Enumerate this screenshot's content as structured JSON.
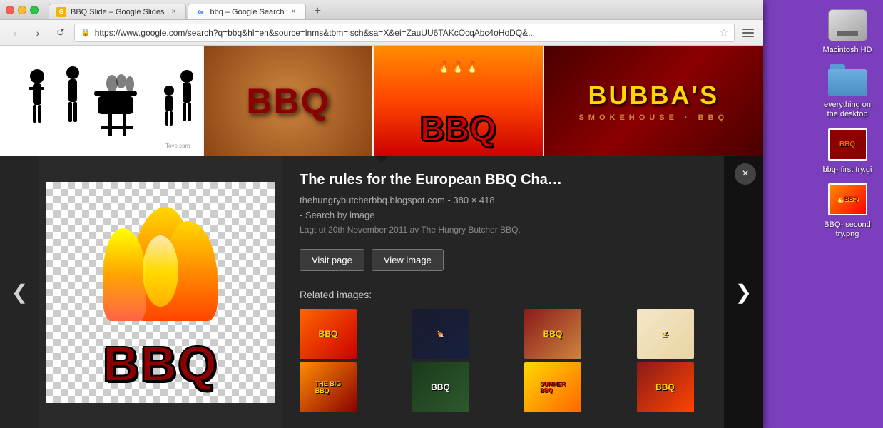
{
  "desktop": {
    "background_color": "#7B3FBE"
  },
  "desktop_icons": [
    {
      "id": "macintosh-hd",
      "label": "Macintosh HD",
      "type": "hard-drive"
    },
    {
      "id": "everything-on-the-desktop",
      "label": "everything on the desktop",
      "type": "folder"
    },
    {
      "id": "bbq-first-try",
      "label": "bbq- first try.gi",
      "type": "bbq-gif"
    },
    {
      "id": "bbq-second-try",
      "label": "BBQ- second try.png",
      "type": "bbq-png"
    }
  ],
  "browser": {
    "tabs": [
      {
        "id": "tab-slides",
        "label": "BBQ Slide – Google Slides",
        "active": false,
        "favicon_type": "slides"
      },
      {
        "id": "tab-search",
        "label": "bbq – Google Search",
        "active": true,
        "favicon_type": "google"
      }
    ],
    "new_tab_label": "+",
    "nav": {
      "back_label": "‹",
      "forward_label": "›",
      "reload_label": "↺",
      "url": "https://www.google.com/search?q=bbq&hl=en&source=lnms&tbm=isch&sa=X&ei=ZauUU6TAKcOcqAbc4oHoDQ&...",
      "url_display": "https://www.google.com/search?q=bbq&hl=en&source=lnms&tbm=isch&sa=X&ei=ZauUU6TAKcOcqAbc4oHoDQ&..."
    }
  },
  "image_overlay": {
    "title": "The rules for the European BBQ Cha…",
    "source": "thehungrybutcherbbq.blogspot.com",
    "dimensions": "380 × 418",
    "search_by_image_label": "- Search by image",
    "date_text": "Lagt ut 20th November 2011 av The Hungry Butcher BBQ.",
    "visit_page_btn": "Visit page",
    "view_image_btn": "View image",
    "related_images_title": "Related images:",
    "related_images": [
      {
        "id": "ri-1",
        "label": "BBQ"
      },
      {
        "id": "ri-2",
        "label": ""
      },
      {
        "id": "ri-3",
        "label": "BBQ"
      },
      {
        "id": "ri-4",
        "label": ""
      },
      {
        "id": "ri-5",
        "label": "BBQ"
      },
      {
        "id": "ri-6",
        "label": ""
      },
      {
        "id": "ri-7",
        "label": "SUMMER BBQ"
      },
      {
        "id": "ri-8",
        "label": "BBQ"
      }
    ],
    "close_btn": "×",
    "prev_arrow": "❮",
    "next_arrow": "❯"
  },
  "strip_images": [
    {
      "id": "si-1",
      "alt": "BBQ people silhouette"
    },
    {
      "id": "si-2",
      "alt": "BBQ brick text"
    },
    {
      "id": "si-3",
      "alt": "BBQ fire text"
    },
    {
      "id": "si-4",
      "alt": "Bubba's Smokehouse BBQ"
    }
  ]
}
